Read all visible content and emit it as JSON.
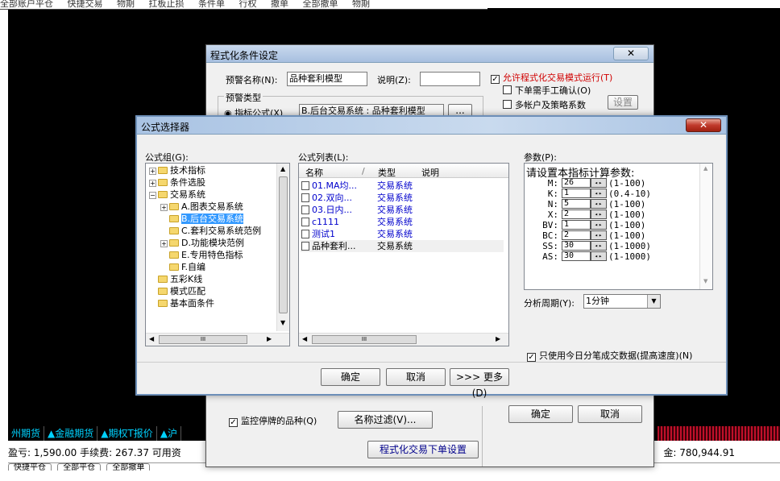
{
  "topbar": {
    "items": [
      "全部账户平仓",
      "快捷交易",
      "物期",
      "扛板止损",
      "条件单",
      "行权",
      "撤单",
      "全部撤单",
      "物期"
    ]
  },
  "tickers": [
    "州期货",
    "▲金融期货",
    "▲期权T报价",
    "▲沪"
  ],
  "status": {
    "left_text": "盈亏: 1,590.00   手续费: 267.37   可用资",
    "right_text": "金: 780,944.91"
  },
  "bottom_buttons": [
    "快捷平仓",
    "全部平仓",
    "全部撤单"
  ],
  "cond_dialog": {
    "title": "程式化条件设定",
    "name_label": "预警名称(N):",
    "name_value": "品种套利模型",
    "desc_label": "说明(Z):",
    "desc_value": "",
    "allow_label": "允许程式化交易模式运行(T)",
    "manual_confirm_label": "下单需手工确认(O)",
    "multi_account_label": "多帐户及策略系数",
    "settings_button": "设置",
    "type_group_label": "预警类型",
    "indicator_radio_label": "指标公式(X)",
    "indicator_value": "B.后台交易系统 : 品种套利模型",
    "browse_button": "...",
    "monitor_halt_label": "监控停牌的品种(Q)",
    "name_filter_button": "名称过滤(V)...",
    "order_settings_button": "程式化交易下单设置",
    "ok_button": "确定",
    "cancel_button": "取消"
  },
  "formula_dialog": {
    "title": "公式选择器",
    "group_label": "公式组(G):",
    "list_label": "公式列表(L):",
    "params_label": "参数(P):",
    "tree": [
      {
        "label": "技术指标",
        "expander": "+",
        "indent": 0
      },
      {
        "label": "条件选股",
        "expander": "+",
        "indent": 0
      },
      {
        "label": "交易系统",
        "expander": "-",
        "indent": 0
      },
      {
        "label": "A.图表交易系统",
        "expander": "+",
        "indent": 1
      },
      {
        "label": "B.后台交易系统",
        "expander": "",
        "indent": 1,
        "selected": true
      },
      {
        "label": "C.套利交易系统范例",
        "expander": "",
        "indent": 1
      },
      {
        "label": "D.功能模块范例",
        "expander": "+",
        "indent": 1
      },
      {
        "label": "E.专用特色指标",
        "expander": "",
        "indent": 1
      },
      {
        "label": "F.自编",
        "expander": "",
        "indent": 1
      },
      {
        "label": "五彩K线",
        "expander": "",
        "indent": 0
      },
      {
        "label": "模式匹配",
        "expander": "",
        "indent": 0
      },
      {
        "label": "基本面条件",
        "expander": "",
        "indent": 0
      }
    ],
    "columns": [
      "名称",
      "/",
      "类型",
      "说明"
    ],
    "formulas": [
      {
        "name": "01.MA均...",
        "type": "交易系统",
        "blue": true
      },
      {
        "name": "02.双向...",
        "type": "交易系统",
        "blue": true
      },
      {
        "name": "03.日内...",
        "type": "交易系统",
        "blue": true
      },
      {
        "name": "c1111",
        "type": "交易系统",
        "blue": true
      },
      {
        "name": "测试1",
        "type": "交易系统",
        "blue": true
      },
      {
        "name": "品种套利...",
        "type": "交易系统",
        "blue": false
      }
    ],
    "params_title": "请设置本指标计算参数:",
    "params": [
      {
        "name": "M:",
        "value": "26",
        "range": "(1-100)"
      },
      {
        "name": "K:",
        "value": "1",
        "range": "(0.4-10)"
      },
      {
        "name": "N:",
        "value": "5",
        "range": "(1-100)"
      },
      {
        "name": "X:",
        "value": "2",
        "range": "(1-100)"
      },
      {
        "name": "BV:",
        "value": "1",
        "range": "(1-100)"
      },
      {
        "name": "BC:",
        "value": "2",
        "range": "(1-100)"
      },
      {
        "name": "SS:",
        "value": "30",
        "range": "(1-1000)"
      },
      {
        "name": "AS:",
        "value": "30",
        "range": "(1-1000)"
      }
    ],
    "period_label": "分析周期(Y):",
    "period_value": "1分钟",
    "today_only_label": "只使用今日分笔成交数据(提高速度)(N)",
    "ok_button": "确定",
    "cancel_button": "取消",
    "more_button": ">>> 更多(D)",
    "hscroll_mid": "III"
  },
  "colors": {
    "selection": "#3399ff",
    "close_red": "#c0392b",
    "ticker_cyan": "#00d2ff",
    "allow_red": "#d00000"
  }
}
